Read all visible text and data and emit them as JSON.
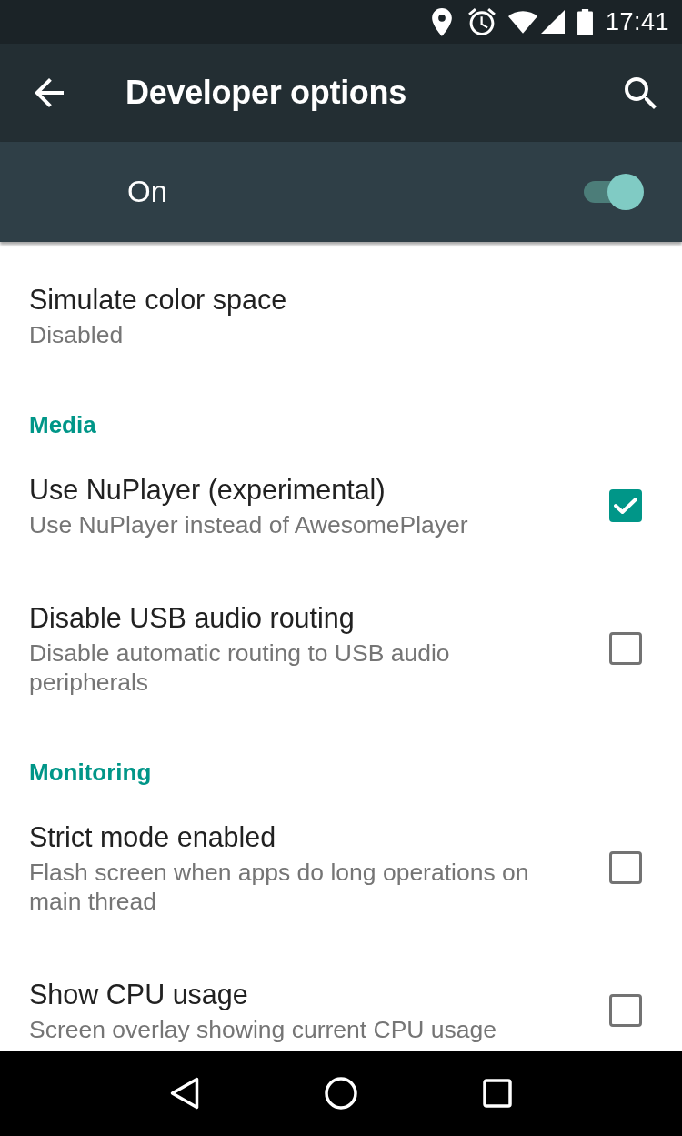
{
  "status_bar": {
    "time": "17:41"
  },
  "app_bar": {
    "title": "Developer options"
  },
  "master_switch": {
    "label": "On",
    "on": true
  },
  "sections": [
    {
      "items": [
        {
          "kind": "text",
          "title": "Simulate color space",
          "summary": "Disabled"
        }
      ]
    },
    {
      "header": "Media",
      "items": [
        {
          "kind": "checkbox",
          "title": "Use NuPlayer (experimental)",
          "summary": "Use NuPlayer instead of AwesomePlayer",
          "checked": true
        },
        {
          "kind": "checkbox",
          "title": "Disable USB audio routing",
          "summary": "Disable automatic routing to USB audio peripherals",
          "checked": false
        }
      ]
    },
    {
      "header": "Monitoring",
      "items": [
        {
          "kind": "checkbox",
          "title": "Strict mode enabled",
          "summary": "Flash screen when apps do long operations on main thread",
          "checked": false
        },
        {
          "kind": "checkbox",
          "title": "Show CPU usage",
          "summary": "Screen overlay showing current CPU usage",
          "checked": false
        }
      ]
    }
  ]
}
